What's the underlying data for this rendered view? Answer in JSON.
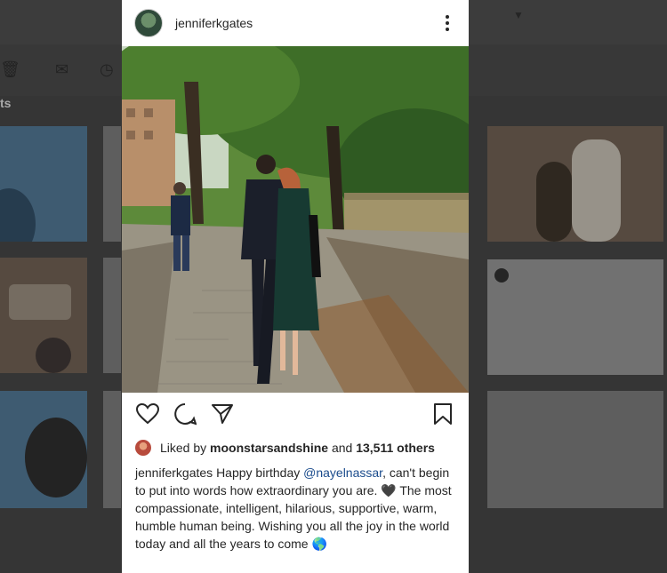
{
  "background": {
    "section_label": "ts"
  },
  "post": {
    "username": "jenniferkgates",
    "likes": {
      "prefix": "Liked by",
      "liker": "moonstarsandshine",
      "connector": "and",
      "others": "13,511 others"
    },
    "caption": {
      "username": "jenniferkgates",
      "text_before": "Happy birthday",
      "mention": "@nayelnassar",
      "text_after": ", can't begin to put into words how extraordinary you are. 🖤 The most compassionate, intelligent, hilarious, supportive, warm, humble human being. Wishing you all the joy in the world today and all the years to come 🌎"
    }
  },
  "icons": {
    "more": "more-options-icon",
    "like": "heart-icon",
    "comment": "comment-icon",
    "share": "send-icon",
    "save": "bookmark-icon"
  }
}
